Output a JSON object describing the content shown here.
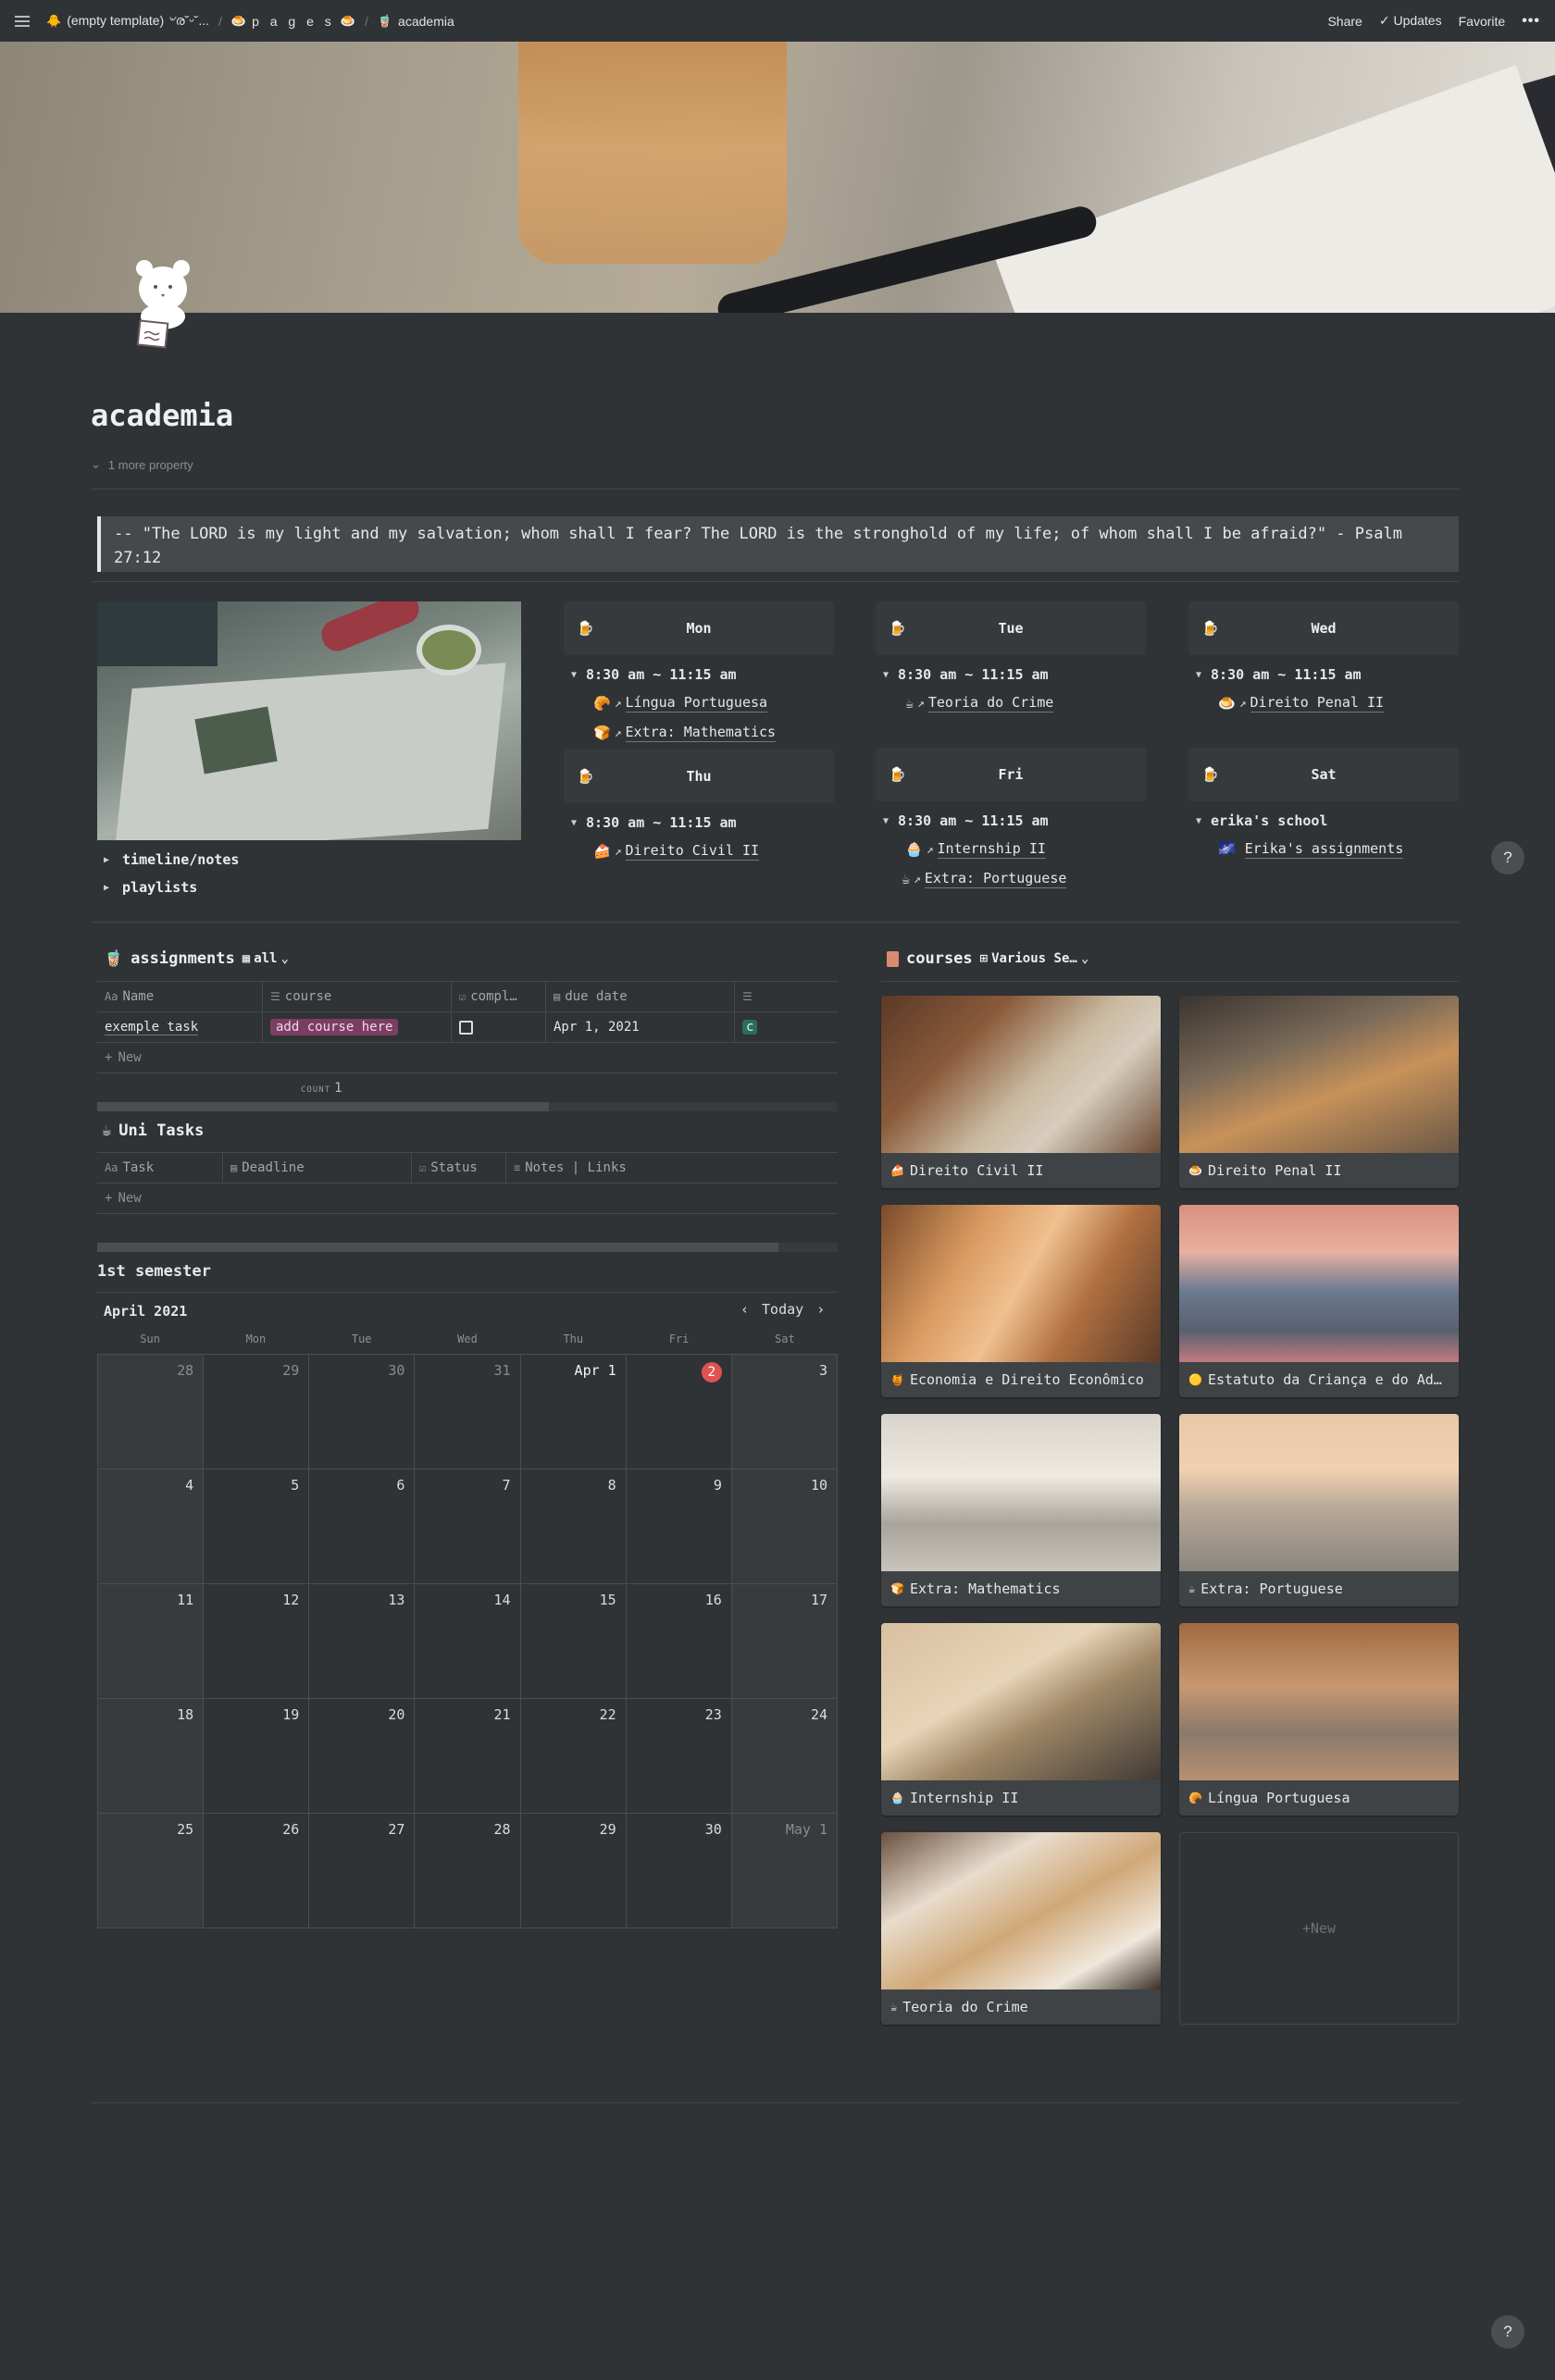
{
  "topbar": {
    "breadcrumbs": [
      {
        "icon": "🐥",
        "label": "(empty template) ৺ര˘ᵕ˘..."
      },
      {
        "icon": "🍮",
        "label": "p a g e s",
        "trail_icon": "🍮"
      },
      {
        "icon": "🧋",
        "label": "academia"
      }
    ],
    "share": "Share",
    "updates": "Updates",
    "favorite": "Favorite",
    "more": "•••"
  },
  "page": {
    "title": "academia",
    "more_property": "1 more property",
    "quote": "-- \"The LORD is my light and my salvation; whom shall I fear? The LORD is the stronghold of my life; of whom shall I be afraid?\" - Psalm 27:12"
  },
  "toggles": [
    "timeline/notes",
    "playlists"
  ],
  "schedule": [
    {
      "day": "Mon",
      "time": "8:30 am ~ 11:15 am",
      "items": [
        {
          "icon": "🥐",
          "label": "Língua Portuguesa"
        },
        {
          "icon": "🍞",
          "label": "Extra: Mathematics"
        }
      ]
    },
    {
      "day": "Tue",
      "time": "8:30 am ~ 11:15 am",
      "items": [
        {
          "icon": "☕",
          "label": "Teoria do Crime"
        }
      ]
    },
    {
      "day": "Wed",
      "time": "8:30 am ~ 11:15 am",
      "items": [
        {
          "icon": "🍮",
          "label": "Direito Penal II"
        }
      ]
    },
    {
      "day": "Thu",
      "time": "8:30 am ~ 11:15 am",
      "items": [
        {
          "icon": "🍰",
          "label": "Direito Civil II"
        }
      ]
    },
    {
      "day": "Fri",
      "time": "8:30 am ~ 11:15 am",
      "items": [
        {
          "icon": "🧁",
          "label": "Internship II"
        },
        {
          "icon": "☕",
          "label": "Extra: Portuguese"
        }
      ]
    },
    {
      "day": "Sat",
      "time": "erika's school",
      "items": [
        {
          "icon": "🌌",
          "label": "Erika's assignments"
        }
      ]
    }
  ],
  "assignments": {
    "title": "assignments",
    "view": "all",
    "columns": [
      "Name",
      "course",
      "compl…",
      "due date"
    ],
    "rows": [
      {
        "name": "exemple task",
        "course": "add course here",
        "completed": false,
        "due": "Apr 1, 2021",
        "extra": "c"
      }
    ],
    "new_label": "New",
    "count_label": "COUNT",
    "count": "1",
    "scroll_fraction": 0.61
  },
  "uni_tasks": {
    "title": "Uni Tasks",
    "columns": [
      "Task",
      "Deadline",
      "Status",
      "Notes | Links"
    ],
    "new_label": "New",
    "scroll_fraction": 0.92
  },
  "calendar": {
    "title": "1st semester",
    "month": "April 2021",
    "today_label": "Today",
    "weekdays": [
      "Sun",
      "Mon",
      "Tue",
      "Wed",
      "Thu",
      "Fri",
      "Sat"
    ],
    "weeks": [
      [
        "28",
        "29",
        "30",
        "31",
        "Apr 1",
        "2",
        "3"
      ],
      [
        "4",
        "5",
        "6",
        "7",
        "8",
        "9",
        "10"
      ],
      [
        "11",
        "12",
        "13",
        "14",
        "15",
        "16",
        "17"
      ],
      [
        "18",
        "19",
        "20",
        "21",
        "22",
        "23",
        "24"
      ],
      [
        "25",
        "26",
        "27",
        "28",
        "29",
        "30",
        "May 1"
      ]
    ],
    "today": "2"
  },
  "courses": {
    "title": "courses",
    "view": "Various Se…",
    "cards": [
      {
        "icon": "🍰",
        "label": "Direito Civil II"
      },
      {
        "icon": "🍮",
        "label": "Direito Penal II"
      },
      {
        "icon": "🍯",
        "label": "Economia e Direito Econômico"
      },
      {
        "icon": "🟡",
        "label": "Estatuto da Criança e do Ad…"
      },
      {
        "icon": "🍞",
        "label": "Extra: Mathematics"
      },
      {
        "icon": "☕",
        "label": "Extra: Portuguese"
      },
      {
        "icon": "🧁",
        "label": "Internship II"
      },
      {
        "icon": "🥐",
        "label": "Língua Portuguesa"
      },
      {
        "icon": "☕",
        "label": "Teoria do Crime"
      }
    ],
    "new_label": "New"
  },
  "help": "?",
  "colors": {
    "background": "#2f3336",
    "tag": "#7b3e62",
    "today_badge": "#e05252"
  }
}
